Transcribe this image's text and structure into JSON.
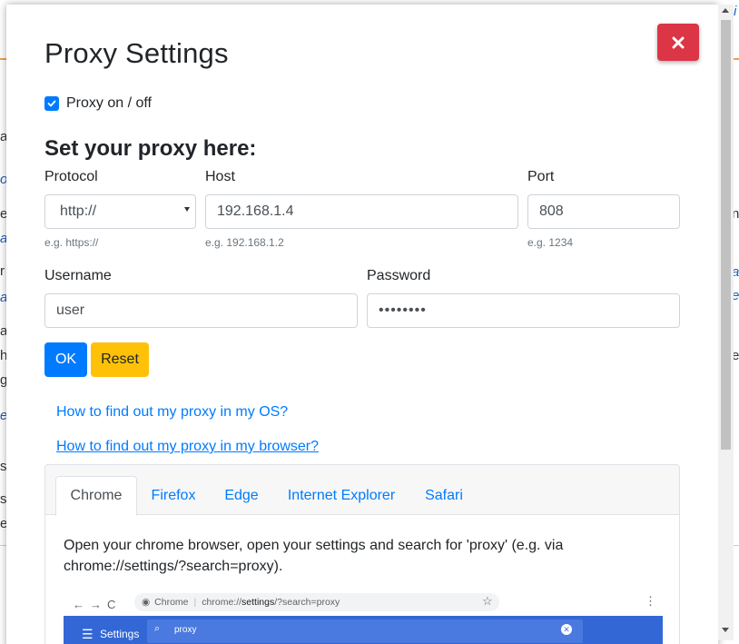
{
  "modal": {
    "title": "Proxy Settings",
    "close_label": "✕",
    "proxy_toggle": {
      "label": "Proxy on / off",
      "checked": true
    },
    "section_title": "Set your proxy here:",
    "protocol": {
      "label": "Protocol",
      "value": "http://",
      "hint": "e.g. https://"
    },
    "host": {
      "label": "Host",
      "value": "192.168.1.4",
      "hint": "e.g. 192.168.1.2"
    },
    "port": {
      "label": "Port",
      "value": "808",
      "hint": "e.g. 1234"
    },
    "username": {
      "label": "Username",
      "value": "user"
    },
    "password": {
      "label": "Password",
      "value": "••••••••"
    },
    "buttons": {
      "ok": "OK",
      "reset": "Reset"
    },
    "links": [
      "How to find out my proxy in my OS?",
      "How to find out my proxy in my browser?"
    ],
    "tabs": [
      "Chrome",
      "Firefox",
      "Edge",
      "Internet Explorer",
      "Safari"
    ],
    "active_tab": "Chrome",
    "instructions": "Open your chrome browser, open your settings and search for 'proxy' (e.g. via chrome://settings/?search=proxy).",
    "screenshot": {
      "omnibox_brand": "Chrome",
      "omnibox_url_prefix": "chrome://",
      "omnibox_url_path": "settings",
      "omnibox_url_suffix": "/?search=proxy",
      "settings_title": "Settings",
      "search_query": "proxy"
    }
  },
  "background": {
    "fragments": [
      "a",
      "or",
      "e",
      "a",
      "r",
      "a",
      "a",
      "h",
      "g",
      "e",
      "sk",
      "s",
      "e",
      "i",
      "n",
      "a",
      "e",
      "e",
      "e"
    ]
  },
  "colors": {
    "primary": "#007bff",
    "danger": "#dc3545",
    "warning": "#ffc107",
    "chrome_blue": "#3367d6"
  }
}
